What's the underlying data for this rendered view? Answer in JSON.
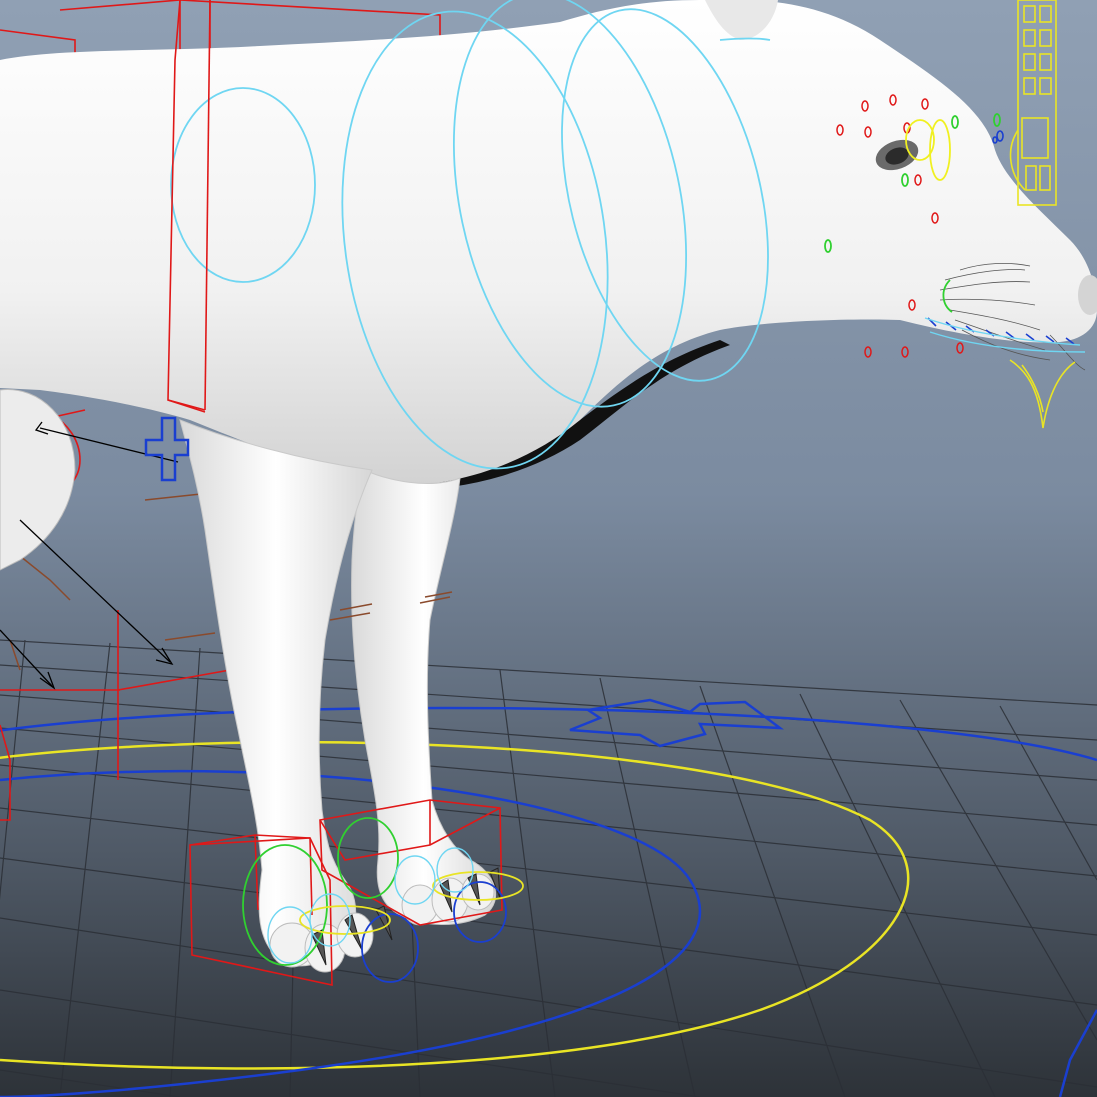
{
  "viewport": {
    "view": "perspective",
    "background_gradient": [
      "#90a0b4",
      "#7b8ba0",
      "#4f5966",
      "#2d3238"
    ],
    "model_color": "#f3f3f3",
    "grid_color": "#2b2f36"
  },
  "rig_colors": {
    "fk_control": "#e01818",
    "spine_ring": "#6fd6f2",
    "world_root": "#e9e425",
    "world_offset": "#1a3fd0",
    "pole_vector": "#000000",
    "joint_brown": "#8a4a2c",
    "face_green": "#30d030",
    "face_yellow": "#f0f020"
  },
  "icons": [
    "move-cross-icon",
    "pole-arrow-icon",
    "direction-arrow-icon",
    "face-control-icon"
  ]
}
